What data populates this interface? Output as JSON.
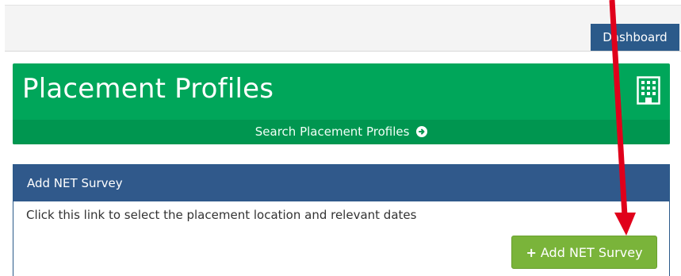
{
  "header": {
    "dashboard_label": "Dashboard"
  },
  "hero": {
    "title": "Placement Profiles",
    "search_link": "Search Placement Profiles",
    "icon": "building-icon"
  },
  "panel": {
    "title": "Add NET Survey",
    "description": "Click this link to select the placement location and relevant dates",
    "button_plus": "+",
    "button_label": "Add NET Survey"
  },
  "colors": {
    "hero_green": "#00a65a",
    "panel_blue": "#30598b",
    "button_green": "#7ab43a",
    "annotation_red": "#e0001b"
  }
}
